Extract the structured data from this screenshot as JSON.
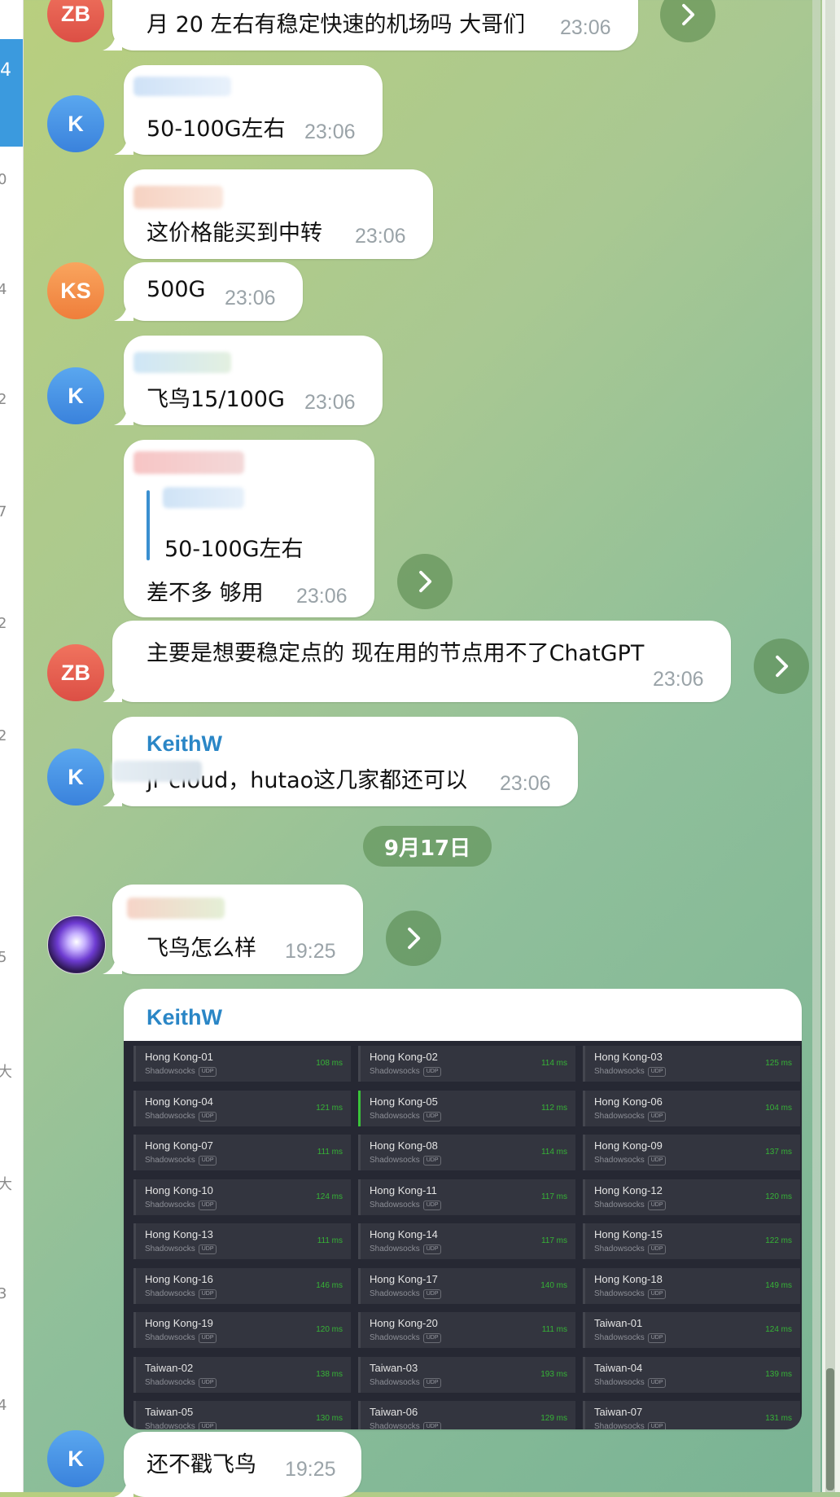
{
  "sidebar_fragments": [
    "4",
    "0",
    "4",
    "2",
    "7",
    "2",
    "2",
    "5",
    "大",
    "大",
    "3",
    "4"
  ],
  "messages": [
    {
      "id": "m1",
      "avatar": "ZB",
      "text": "月 20 左右有稳定快速的机场吗 大哥们",
      "time": "23:06"
    },
    {
      "id": "m2",
      "avatar": "K",
      "text": "50-100G左右",
      "time": "23:06"
    },
    {
      "id": "m3",
      "text": "这价格能买到中转",
      "time": "23:06"
    },
    {
      "id": "m4",
      "avatar": "KS",
      "text": "500G",
      "time": "23:06"
    },
    {
      "id": "m5",
      "avatar": "K",
      "text": "飞鸟15/100G",
      "time": "23:06"
    },
    {
      "id": "m6",
      "reply_text": "50-100G左右",
      "text": "差不多  够用",
      "time": "23:06"
    },
    {
      "id": "m7",
      "avatar": "ZB",
      "text": "主要是想要稳定点的 现在用的节点用不了ChatGPT",
      "time": "23:06"
    },
    {
      "id": "m8",
      "avatar": "K",
      "sender": "KeithW",
      "text": "jr cloud，hutao这几家都还可以",
      "time": "23:06"
    },
    {
      "id": "m9",
      "text": "飞鸟怎么样",
      "time": "19:25"
    },
    {
      "id": "m10",
      "sender": "KeithW"
    },
    {
      "id": "m11",
      "avatar": "K",
      "text": "还不戳飞鸟",
      "time": "19:25"
    }
  ],
  "date_separator": "9月17日",
  "proxy_list": {
    "protocol": "Shadowsocks",
    "udp_tag": "UDP",
    "nodes": [
      {
        "name": "Hong Kong-01",
        "latency": "108 ms"
      },
      {
        "name": "Hong Kong-02",
        "latency": "114 ms"
      },
      {
        "name": "Hong Kong-03",
        "latency": "125 ms"
      },
      {
        "name": "Hong Kong-04",
        "latency": "121 ms"
      },
      {
        "name": "Hong Kong-05",
        "latency": "112 ms",
        "active": true
      },
      {
        "name": "Hong Kong-06",
        "latency": "104 ms"
      },
      {
        "name": "Hong Kong-07",
        "latency": "111 ms"
      },
      {
        "name": "Hong Kong-08",
        "latency": "114 ms"
      },
      {
        "name": "Hong Kong-09",
        "latency": "137 ms"
      },
      {
        "name": "Hong Kong-10",
        "latency": "124 ms"
      },
      {
        "name": "Hong Kong-11",
        "latency": "117 ms"
      },
      {
        "name": "Hong Kong-12",
        "latency": "120 ms"
      },
      {
        "name": "Hong Kong-13",
        "latency": "111 ms"
      },
      {
        "name": "Hong Kong-14",
        "latency": "117 ms"
      },
      {
        "name": "Hong Kong-15",
        "latency": "122 ms"
      },
      {
        "name": "Hong Kong-16",
        "latency": "146 ms"
      },
      {
        "name": "Hong Kong-17",
        "latency": "140 ms"
      },
      {
        "name": "Hong Kong-18",
        "latency": "149 ms"
      },
      {
        "name": "Hong Kong-19",
        "latency": "120 ms"
      },
      {
        "name": "Hong Kong-20",
        "latency": "111 ms"
      },
      {
        "name": "Taiwan-01",
        "latency": "124 ms"
      },
      {
        "name": "Taiwan-02",
        "latency": "138 ms"
      },
      {
        "name": "Taiwan-03",
        "latency": "193 ms"
      },
      {
        "name": "Taiwan-04",
        "latency": "139 ms"
      },
      {
        "name": "Taiwan-05",
        "latency": "130 ms"
      },
      {
        "name": "Taiwan-06",
        "latency": "129 ms"
      },
      {
        "name": "Taiwan-07",
        "latency": "131 ms"
      }
    ]
  },
  "colors": {
    "accent": "#3a8fd0",
    "sender_name": "#2a86c6",
    "latency": "#36b336",
    "avatar_red": "#e4594b",
    "avatar_blue": "#3f8ee0",
    "avatar_orange": "#f28c45"
  }
}
